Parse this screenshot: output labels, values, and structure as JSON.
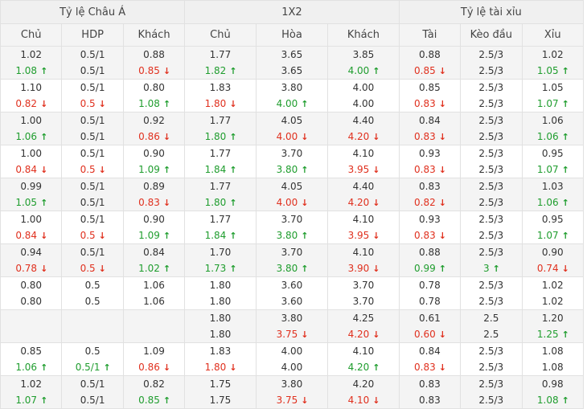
{
  "groups": [
    "Tỷ lệ Châu Á",
    "1X2",
    "Tỷ lệ tài xỉu"
  ],
  "columns": [
    "Chủ",
    "HDP",
    "Khách",
    "Chủ",
    "Hòa",
    "Khách",
    "Tài",
    "Kèo đầu",
    "Xỉu"
  ],
  "arrow_up": "↑",
  "arrow_down": "↓",
  "colors": {
    "up": "#1f9d2e",
    "down": "#e0301e"
  },
  "rows": [
    [
      [
        "1.02",
        "1.08",
        "up"
      ],
      [
        "0.5/1",
        "0.5/1",
        ""
      ],
      [
        "0.88",
        "0.85",
        "down"
      ],
      [
        "1.77",
        "1.82",
        "up"
      ],
      [
        "3.65",
        "3.65",
        ""
      ],
      [
        "3.85",
        "4.00",
        "up"
      ],
      [
        "0.88",
        "0.85",
        "down"
      ],
      [
        "2.5/3",
        "2.5/3",
        ""
      ],
      [
        "1.02",
        "1.05",
        "up"
      ]
    ],
    [
      [
        "1.10",
        "0.82",
        "down"
      ],
      [
        "0.5/1",
        "0.5",
        "down"
      ],
      [
        "0.80",
        "1.08",
        "up"
      ],
      [
        "1.83",
        "1.80",
        "down"
      ],
      [
        "3.80",
        "4.00",
        "up"
      ],
      [
        "4.00",
        "4.00",
        ""
      ],
      [
        "0.85",
        "0.83",
        "down"
      ],
      [
        "2.5/3",
        "2.5/3",
        ""
      ],
      [
        "1.05",
        "1.07",
        "up"
      ]
    ],
    [
      [
        "1.00",
        "1.06",
        "up"
      ],
      [
        "0.5/1",
        "0.5/1",
        ""
      ],
      [
        "0.92",
        "0.86",
        "down"
      ],
      [
        "1.77",
        "1.80",
        "up"
      ],
      [
        "4.05",
        "4.00",
        "down"
      ],
      [
        "4.40",
        "4.20",
        "down"
      ],
      [
        "0.84",
        "0.83",
        "down"
      ],
      [
        "2.5/3",
        "2.5/3",
        ""
      ],
      [
        "1.06",
        "1.06",
        "up"
      ]
    ],
    [
      [
        "1.00",
        "0.84",
        "down"
      ],
      [
        "0.5/1",
        "0.5",
        "down"
      ],
      [
        "0.90",
        "1.09",
        "up"
      ],
      [
        "1.77",
        "1.84",
        "up"
      ],
      [
        "3.70",
        "3.80",
        "up"
      ],
      [
        "4.10",
        "3.95",
        "down"
      ],
      [
        "0.93",
        "0.83",
        "down"
      ],
      [
        "2.5/3",
        "2.5/3",
        ""
      ],
      [
        "0.95",
        "1.07",
        "up"
      ]
    ],
    [
      [
        "0.99",
        "1.05",
        "up"
      ],
      [
        "0.5/1",
        "0.5/1",
        ""
      ],
      [
        "0.89",
        "0.83",
        "down"
      ],
      [
        "1.77",
        "1.80",
        "up"
      ],
      [
        "4.05",
        "4.00",
        "down"
      ],
      [
        "4.40",
        "4.20",
        "down"
      ],
      [
        "0.83",
        "0.82",
        "down"
      ],
      [
        "2.5/3",
        "2.5/3",
        ""
      ],
      [
        "1.03",
        "1.06",
        "up"
      ]
    ],
    [
      [
        "1.00",
        "0.84",
        "down"
      ],
      [
        "0.5/1",
        "0.5",
        "down"
      ],
      [
        "0.90",
        "1.09",
        "up"
      ],
      [
        "1.77",
        "1.84",
        "up"
      ],
      [
        "3.70",
        "3.80",
        "up"
      ],
      [
        "4.10",
        "3.95",
        "down"
      ],
      [
        "0.93",
        "0.83",
        "down"
      ],
      [
        "2.5/3",
        "2.5/3",
        ""
      ],
      [
        "0.95",
        "1.07",
        "up"
      ]
    ],
    [
      [
        "0.94",
        "0.78",
        "down"
      ],
      [
        "0.5/1",
        "0.5",
        "down"
      ],
      [
        "0.84",
        "1.02",
        "up"
      ],
      [
        "1.70",
        "1.73",
        "up"
      ],
      [
        "3.70",
        "3.80",
        "up"
      ],
      [
        "4.10",
        "3.90",
        "down"
      ],
      [
        "0.88",
        "0.99",
        "up"
      ],
      [
        "2.5/3",
        "3",
        "up"
      ],
      [
        "0.90",
        "0.74",
        "down"
      ]
    ],
    [
      [
        "0.80",
        "0.80",
        ""
      ],
      [
        "0.5",
        "0.5",
        ""
      ],
      [
        "1.06",
        "1.06",
        ""
      ],
      [
        "1.80",
        "1.80",
        ""
      ],
      [
        "3.60",
        "3.60",
        ""
      ],
      [
        "3.70",
        "3.70",
        ""
      ],
      [
        "0.78",
        "0.78",
        ""
      ],
      [
        "2.5/3",
        "2.5/3",
        ""
      ],
      [
        "1.02",
        "1.02",
        ""
      ]
    ],
    [
      [
        "",
        "",
        ""
      ],
      [
        "",
        "",
        ""
      ],
      [
        "",
        "",
        ""
      ],
      [
        "1.80",
        "1.80",
        ""
      ],
      [
        "3.80",
        "3.75",
        "down"
      ],
      [
        "4.25",
        "4.20",
        "down"
      ],
      [
        "0.61",
        "0.60",
        "down"
      ],
      [
        "2.5",
        "2.5",
        ""
      ],
      [
        "1.20",
        "1.25",
        "up"
      ]
    ],
    [
      [
        "0.85",
        "1.06",
        "up"
      ],
      [
        "0.5",
        "0.5/1",
        "up"
      ],
      [
        "1.09",
        "0.86",
        "down"
      ],
      [
        "1.83",
        "1.80",
        "down"
      ],
      [
        "4.00",
        "4.00",
        ""
      ],
      [
        "4.10",
        "4.20",
        "up"
      ],
      [
        "0.84",
        "0.83",
        "down"
      ],
      [
        "2.5/3",
        "2.5/3",
        ""
      ],
      [
        "1.08",
        "1.08",
        ""
      ]
    ],
    [
      [
        "1.02",
        "1.07",
        "up"
      ],
      [
        "0.5/1",
        "0.5/1",
        ""
      ],
      [
        "0.82",
        "0.85",
        "up"
      ],
      [
        "1.75",
        "1.75",
        ""
      ],
      [
        "3.80",
        "3.75",
        "down"
      ],
      [
        "4.20",
        "4.10",
        "down"
      ],
      [
        "0.83",
        "0.83",
        ""
      ],
      [
        "2.5/3",
        "2.5/3",
        ""
      ],
      [
        "0.98",
        "1.08",
        "up"
      ]
    ]
  ]
}
